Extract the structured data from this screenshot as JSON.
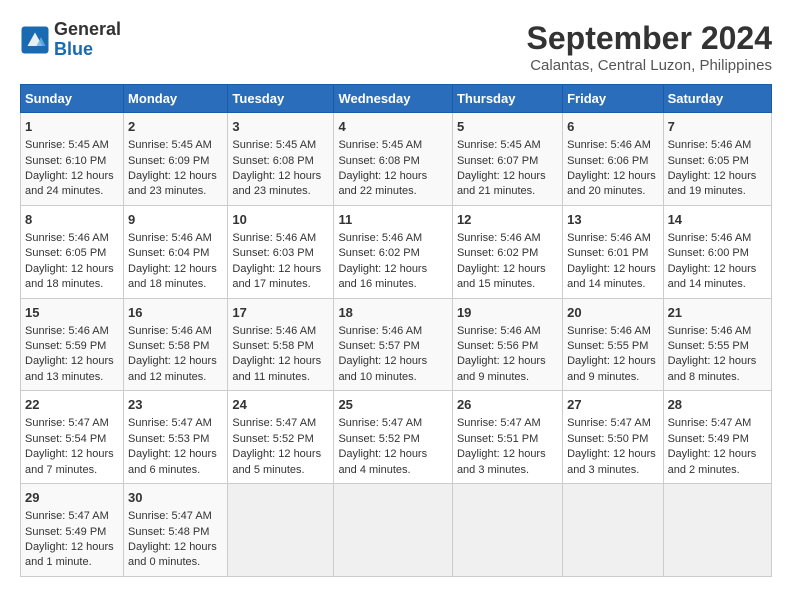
{
  "header": {
    "logo_line1": "General",
    "logo_line2": "Blue",
    "title": "September 2024",
    "subtitle": "Calantas, Central Luzon, Philippines"
  },
  "calendar": {
    "days_of_week": [
      "Sunday",
      "Monday",
      "Tuesday",
      "Wednesday",
      "Thursday",
      "Friday",
      "Saturday"
    ],
    "weeks": [
      [
        {
          "day": "",
          "content": ""
        },
        {
          "day": "",
          "content": ""
        },
        {
          "day": "",
          "content": ""
        },
        {
          "day": "",
          "content": ""
        },
        {
          "day": "",
          "content": ""
        },
        {
          "day": "",
          "content": ""
        },
        {
          "day": "",
          "content": ""
        }
      ]
    ],
    "cells": {
      "week1": {
        "sun": {
          "num": "1",
          "sunrise": "5:45 AM",
          "sunset": "6:10 PM",
          "daylight": "12 hours and 24 minutes."
        },
        "mon": {
          "num": "2",
          "sunrise": "5:45 AM",
          "sunset": "6:09 PM",
          "daylight": "12 hours and 23 minutes."
        },
        "tue": {
          "num": "3",
          "sunrise": "5:45 AM",
          "sunset": "6:08 PM",
          "daylight": "12 hours and 23 minutes."
        },
        "wed": {
          "num": "4",
          "sunrise": "5:45 AM",
          "sunset": "6:08 PM",
          "daylight": "12 hours and 22 minutes."
        },
        "thu": {
          "num": "5",
          "sunrise": "5:45 AM",
          "sunset": "6:07 PM",
          "daylight": "12 hours and 21 minutes."
        },
        "fri": {
          "num": "6",
          "sunrise": "5:46 AM",
          "sunset": "6:06 PM",
          "daylight": "12 hours and 20 minutes."
        },
        "sat": {
          "num": "7",
          "sunrise": "5:46 AM",
          "sunset": "6:05 PM",
          "daylight": "12 hours and 19 minutes."
        }
      },
      "week2": {
        "sun": {
          "num": "8",
          "sunrise": "5:46 AM",
          "sunset": "6:05 PM",
          "daylight": "12 hours and 18 minutes."
        },
        "mon": {
          "num": "9",
          "sunrise": "5:46 AM",
          "sunset": "6:04 PM",
          "daylight": "12 hours and 18 minutes."
        },
        "tue": {
          "num": "10",
          "sunrise": "5:46 AM",
          "sunset": "6:03 PM",
          "daylight": "12 hours and 17 minutes."
        },
        "wed": {
          "num": "11",
          "sunrise": "5:46 AM",
          "sunset": "6:02 PM",
          "daylight": "12 hours and 16 minutes."
        },
        "thu": {
          "num": "12",
          "sunrise": "5:46 AM",
          "sunset": "6:02 PM",
          "daylight": "12 hours and 15 minutes."
        },
        "fri": {
          "num": "13",
          "sunrise": "5:46 AM",
          "sunset": "6:01 PM",
          "daylight": "12 hours and 14 minutes."
        },
        "sat": {
          "num": "14",
          "sunrise": "5:46 AM",
          "sunset": "6:00 PM",
          "daylight": "12 hours and 14 minutes."
        }
      },
      "week3": {
        "sun": {
          "num": "15",
          "sunrise": "5:46 AM",
          "sunset": "5:59 PM",
          "daylight": "12 hours and 13 minutes."
        },
        "mon": {
          "num": "16",
          "sunrise": "5:46 AM",
          "sunset": "5:58 PM",
          "daylight": "12 hours and 12 minutes."
        },
        "tue": {
          "num": "17",
          "sunrise": "5:46 AM",
          "sunset": "5:58 PM",
          "daylight": "12 hours and 11 minutes."
        },
        "wed": {
          "num": "18",
          "sunrise": "5:46 AM",
          "sunset": "5:57 PM",
          "daylight": "12 hours and 10 minutes."
        },
        "thu": {
          "num": "19",
          "sunrise": "5:46 AM",
          "sunset": "5:56 PM",
          "daylight": "12 hours and 9 minutes."
        },
        "fri": {
          "num": "20",
          "sunrise": "5:46 AM",
          "sunset": "5:55 PM",
          "daylight": "12 hours and 9 minutes."
        },
        "sat": {
          "num": "21",
          "sunrise": "5:46 AM",
          "sunset": "5:55 PM",
          "daylight": "12 hours and 8 minutes."
        }
      },
      "week4": {
        "sun": {
          "num": "22",
          "sunrise": "5:47 AM",
          "sunset": "5:54 PM",
          "daylight": "12 hours and 7 minutes."
        },
        "mon": {
          "num": "23",
          "sunrise": "5:47 AM",
          "sunset": "5:53 PM",
          "daylight": "12 hours and 6 minutes."
        },
        "tue": {
          "num": "24",
          "sunrise": "5:47 AM",
          "sunset": "5:52 PM",
          "daylight": "12 hours and 5 minutes."
        },
        "wed": {
          "num": "25",
          "sunrise": "5:47 AM",
          "sunset": "5:52 PM",
          "daylight": "12 hours and 4 minutes."
        },
        "thu": {
          "num": "26",
          "sunrise": "5:47 AM",
          "sunset": "5:51 PM",
          "daylight": "12 hours and 3 minutes."
        },
        "fri": {
          "num": "27",
          "sunrise": "5:47 AM",
          "sunset": "5:50 PM",
          "daylight": "12 hours and 3 minutes."
        },
        "sat": {
          "num": "28",
          "sunrise": "5:47 AM",
          "sunset": "5:49 PM",
          "daylight": "12 hours and 2 minutes."
        }
      },
      "week5": {
        "sun": {
          "num": "29",
          "sunrise": "5:47 AM",
          "sunset": "5:49 PM",
          "daylight": "12 hours and 1 minute."
        },
        "mon": {
          "num": "30",
          "sunrise": "5:47 AM",
          "sunset": "5:48 PM",
          "daylight": "12 hours and 0 minutes."
        },
        "tue": null,
        "wed": null,
        "thu": null,
        "fri": null,
        "sat": null
      }
    }
  }
}
